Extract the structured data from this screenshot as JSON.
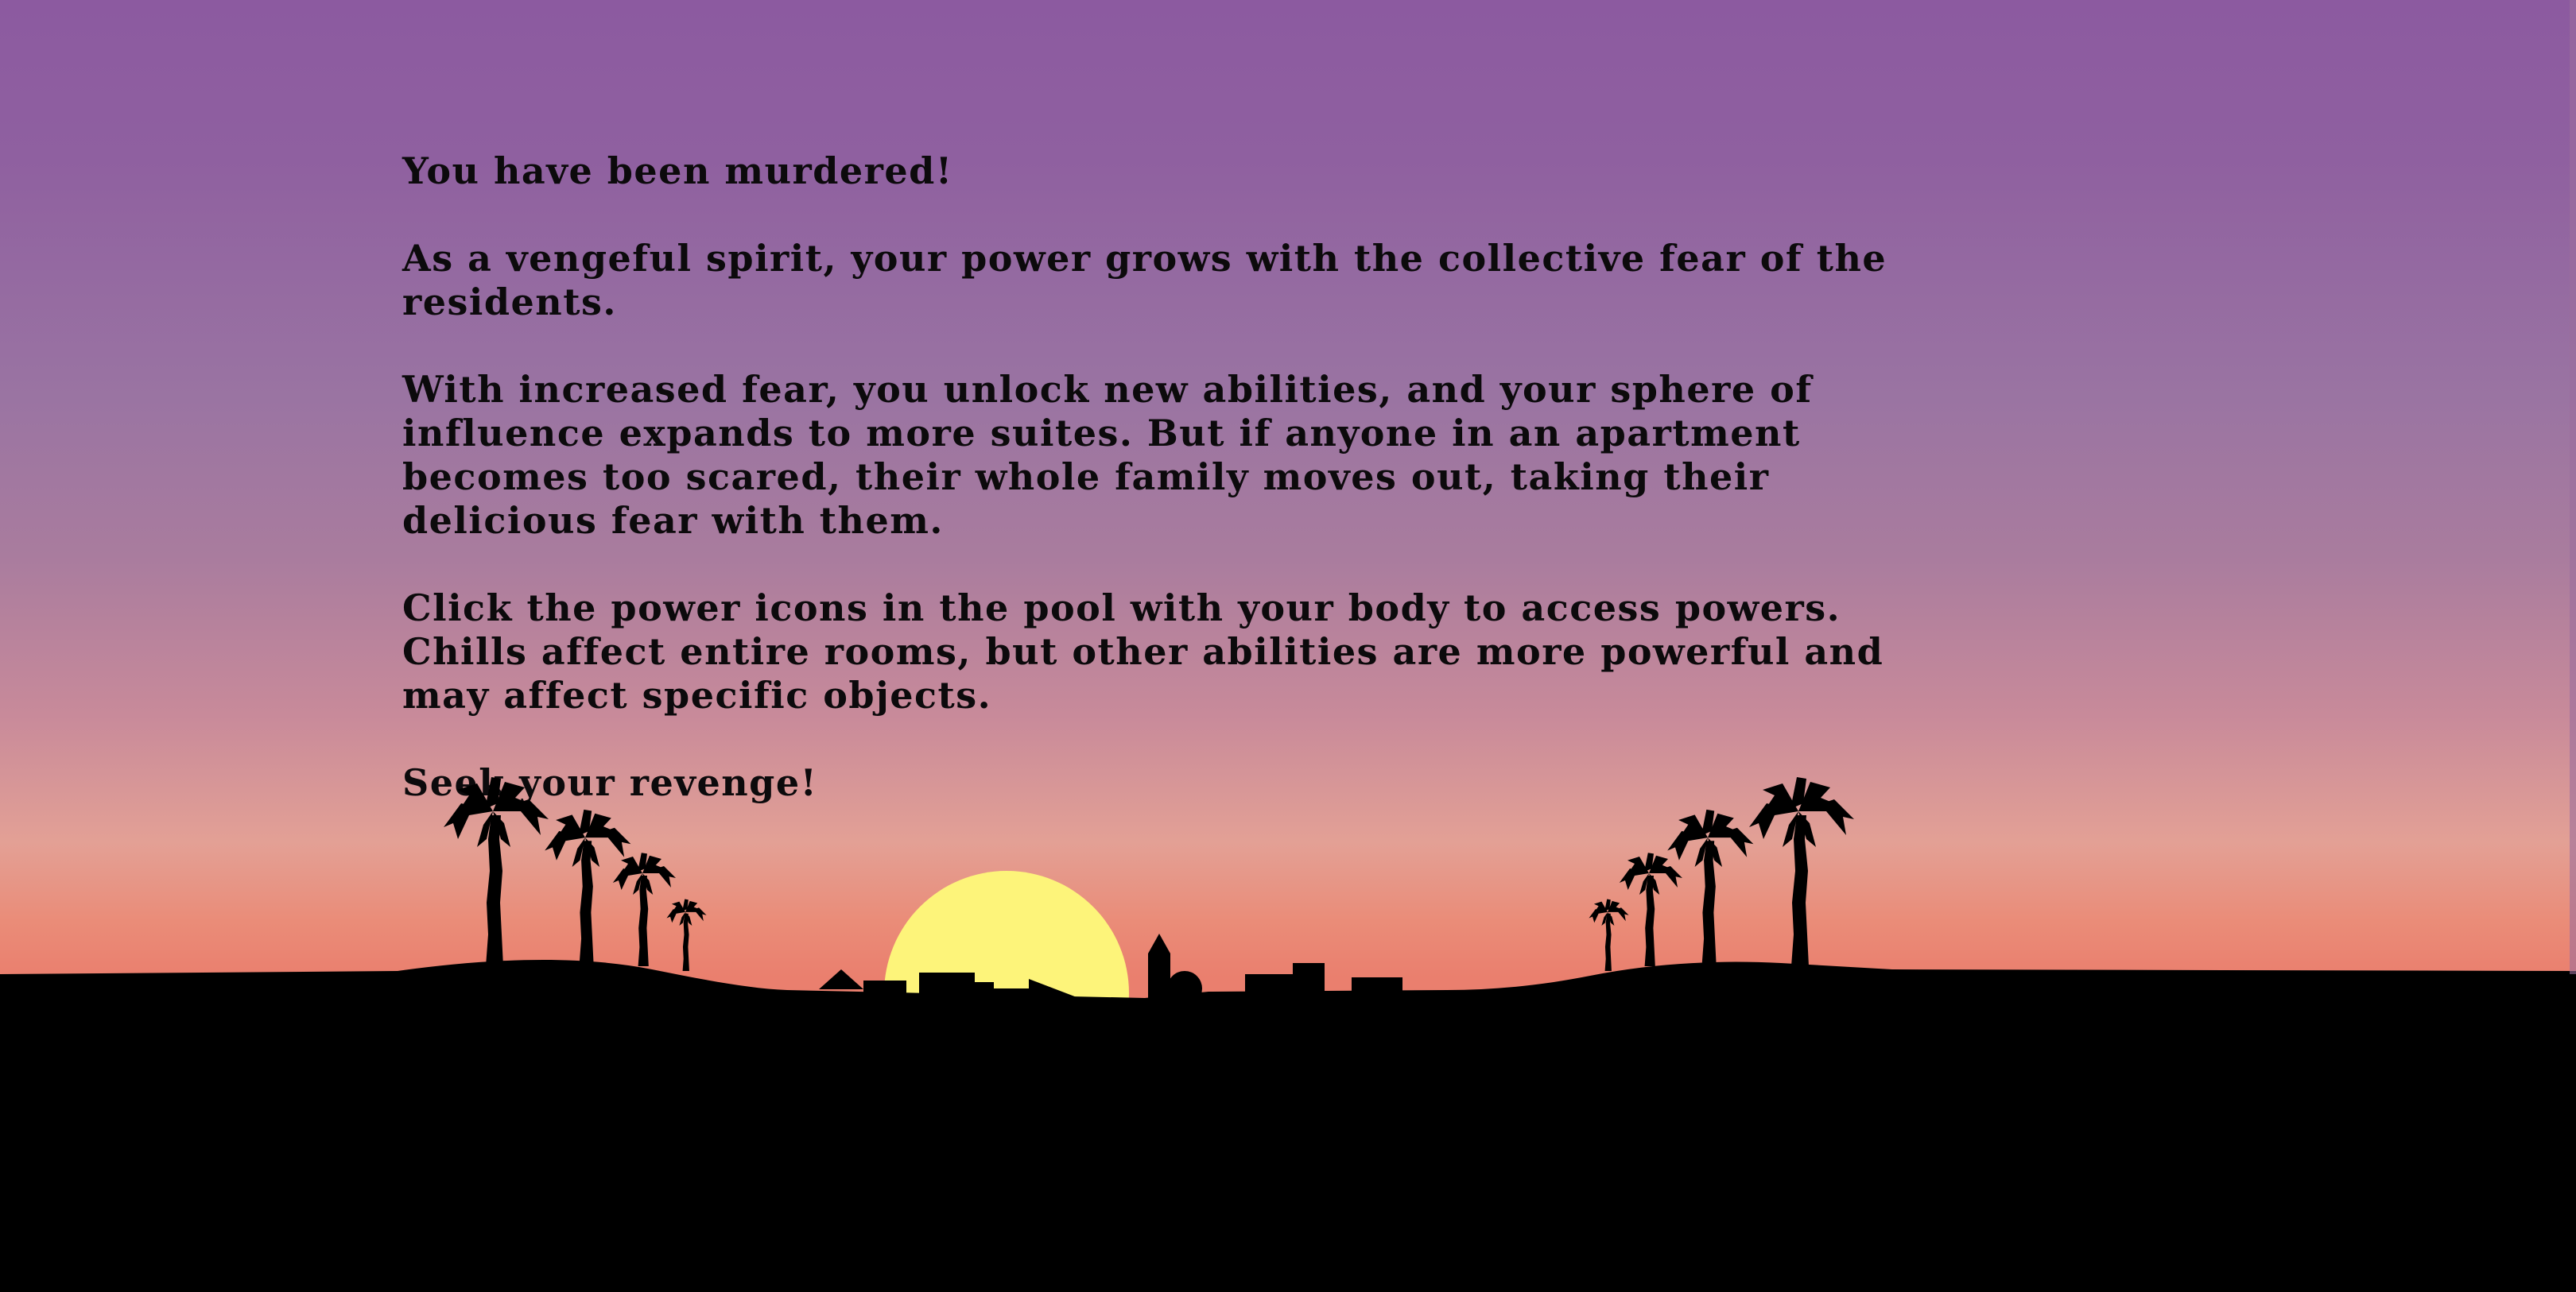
{
  "intro": {
    "title": "You have been murdered!",
    "paragraph1": "As a vengeful spirit, your power grows with the collective fear of the residents.",
    "paragraph2": "With increased fear, you unlock new abilities, and your sphere of influence expands to more suites. But if anyone in an apartment becomes too scared, their whole family moves out, taking their delicious fear with them.",
    "paragraph3": "Click the power icons in the pool with your body to access powers. Chills affect entire rooms, but other abilities are more powerful and may affect specific objects.",
    "closing": "Seek your revenge!"
  },
  "scene": {
    "sky_top_color": "#8c5aa0",
    "sky_bottom_color": "#ea7f6e",
    "sun_color": "#fdf47a",
    "ground_color": "#000000",
    "icons": [
      "palm-tree-icon",
      "sun-icon",
      "city-skyline-icon"
    ]
  }
}
